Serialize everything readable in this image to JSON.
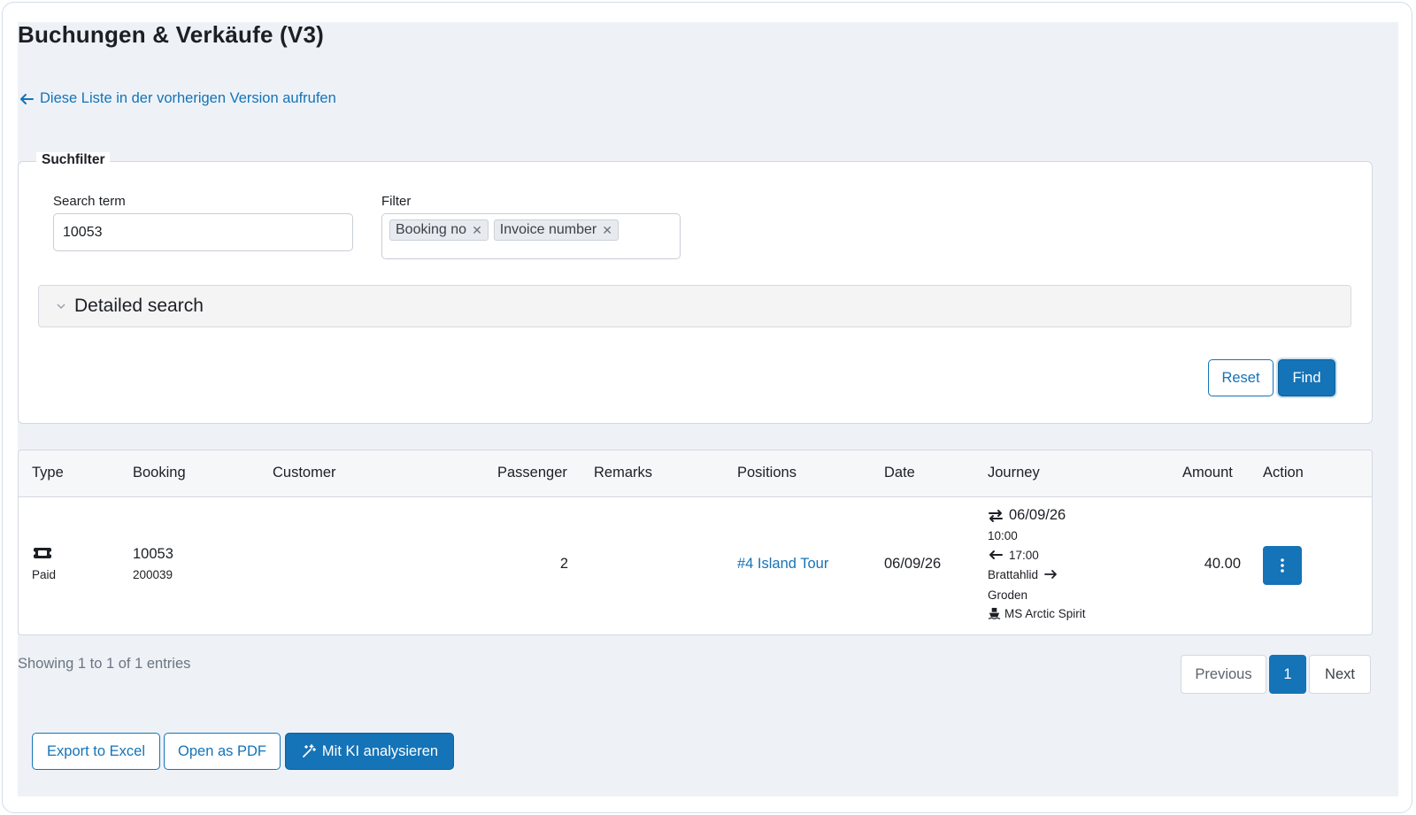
{
  "page": {
    "title": "Buchungen & Verkäufe (V3)",
    "back_link": "Diese Liste in der vorherigen Version aufrufen"
  },
  "filter": {
    "legend": "Suchfilter",
    "search_label": "Search term",
    "search_value": "10053",
    "filter_label": "Filter",
    "chips": [
      "Booking no",
      "Invoice number"
    ],
    "detailed_search": "Detailed search",
    "reset_label": "Reset",
    "find_label": "Find"
  },
  "table": {
    "headers": [
      "Type",
      "Booking",
      "Customer",
      "Passenger",
      "Remarks",
      "Positions",
      "Date",
      "Journey",
      "Amount",
      "Action"
    ],
    "rows": [
      {
        "type_icon": "ticket-icon",
        "type_label": "Paid",
        "booking_no": "10053",
        "invoice_no": "200039",
        "customer": "",
        "passenger": "2",
        "remarks": "",
        "position": "#4 Island Tour",
        "date": "06/09/26",
        "journey": {
          "date": "06/09/26",
          "depart_time": "10:00",
          "return_time": "17:00",
          "from": "Brattahlid",
          "to": "Groden",
          "ship": "MS Arctic Spirit"
        },
        "amount": "40.00"
      }
    ]
  },
  "footer": {
    "showing": "Showing 1 to 1 of 1 entries",
    "previous": "Previous",
    "page": "1",
    "next": "Next",
    "export_excel": "Export to Excel",
    "open_pdf": "Open as PDF",
    "ai_analyze": "Mit KI analysieren"
  },
  "colors": {
    "accent": "#1573b7",
    "background": "#eef2f7"
  }
}
